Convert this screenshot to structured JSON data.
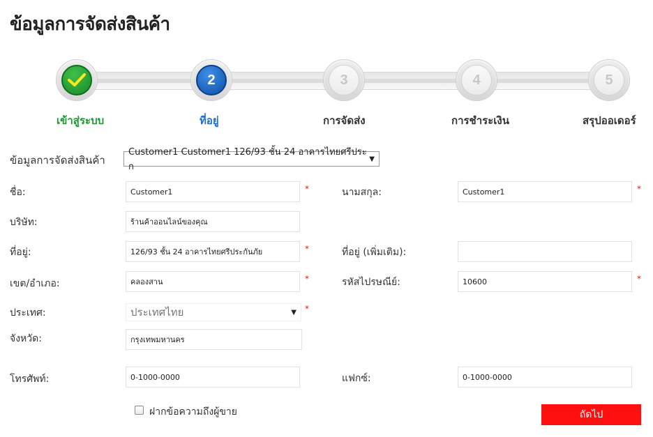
{
  "page_title": "ข้อมูลการจัดส่งสินค้า",
  "steps": [
    {
      "number": "",
      "label": "เข้าสู่ระบบ",
      "state": "done"
    },
    {
      "number": "2",
      "label": "ที่อยู่",
      "state": "active"
    },
    {
      "number": "3",
      "label": "การจัดส่ง",
      "state": "todo"
    },
    {
      "number": "4",
      "label": "การชำระเงิน",
      "state": "todo"
    },
    {
      "number": "5",
      "label": "สรุปออเดอร์",
      "state": "todo"
    }
  ],
  "form": {
    "address_select_label": "ข้อมูลการจัดส่งสินค้า",
    "address_select_value": "Customer1 Customer1 126/93 ชั้น 24 อาคารไทยศรีประก",
    "first_name_label": "ชื่อ:",
    "first_name_value": "Customer1",
    "last_name_label": "นามสกุล:",
    "last_name_value": "Customer1",
    "company_label": "บริษัท:",
    "company_value": "ร้านค้าออนไลน์ของคุณ",
    "address_label": "ที่อยู่:",
    "address_value": "126/93 ชั้น 24 อาคารไทยศรีประกันภัย",
    "address2_label": "ที่อยู่ (เพิ่มเติม):",
    "address2_value": "",
    "district_label": "เขต/อำเภอ:",
    "district_value": "คลองสาน",
    "postcode_label": "รหัสไปรษณีย์:",
    "postcode_value": "10600",
    "country_label": "ประเทศ:",
    "country_value": "ประเทศไทย",
    "province_label": "จังหวัด:",
    "province_value": "กรุงเทพมหานคร",
    "phone_label": "โทรศัพท์:",
    "phone_value": "0-1000-0000",
    "fax_label": "แฟกซ์:",
    "fax_value": "0-1000-0000",
    "required_mark": "*",
    "note_checkbox_label": "ฝากข้อความถึงผู้ขาย",
    "next_button_label": "ถัดไป"
  },
  "colors": {
    "done": "#1a9a32",
    "active": "#1d6fcf",
    "required": "#e02020",
    "next_button": "#ff1010"
  }
}
